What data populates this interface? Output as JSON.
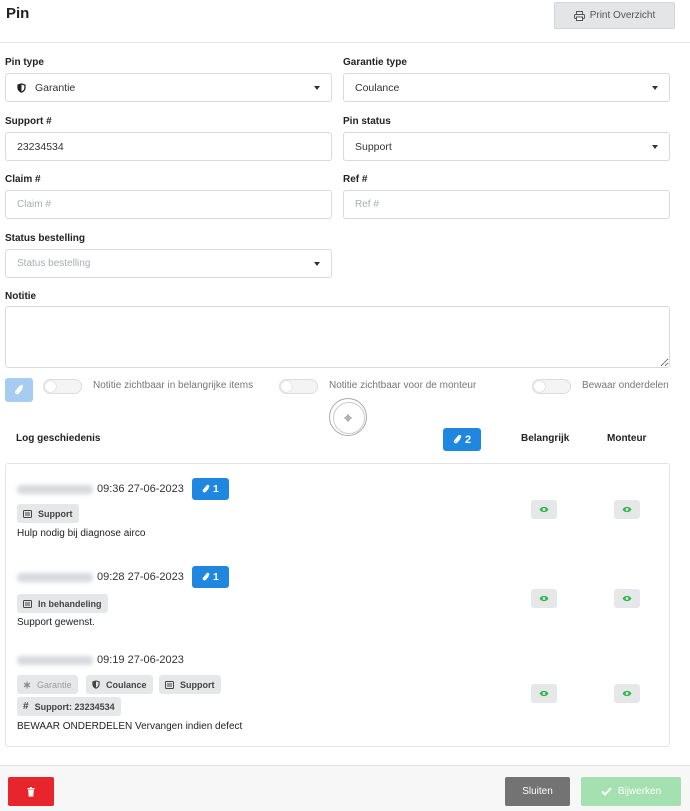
{
  "header": {
    "title": "Pin",
    "print_label": "Print Overzicht"
  },
  "form": {
    "pin_type": {
      "label": "Pin type",
      "value": "Garantie"
    },
    "garantie_type": {
      "label": "Garantie type",
      "value": "Coulance"
    },
    "support": {
      "label": "Support #",
      "value": "23234534"
    },
    "pin_status": {
      "label": "Pin status",
      "value": "Support"
    },
    "claim": {
      "label": "Claim #",
      "placeholder": "Claim #"
    },
    "ref": {
      "label": "Ref #",
      "placeholder": "Ref #"
    },
    "status_bestelling": {
      "label": "Status bestelling",
      "placeholder": "Status bestelling"
    },
    "notitie": {
      "label": "Notitie"
    }
  },
  "toggles": {
    "belangrijk_label": "Notitie zichtbaar in belangrijke items",
    "monteur_label": "Notitie zichtbaar voor de monteur",
    "onderdelen_label": "Bewaar onderdelen"
  },
  "log": {
    "title": "Log geschiedenis",
    "attachment_count": "2",
    "col_belangrijk": "Belangrijk",
    "col_monteur": "Monteur",
    "entries": [
      {
        "time": "09:36 27-06-2023",
        "attachments": "1",
        "tag_support": "Support",
        "text": "Hulp nodig bij diagnose airco"
      },
      {
        "time": "09:28 27-06-2023",
        "attachments": "1",
        "tag_status": "In behandeling",
        "text": "Support gewenst."
      },
      {
        "time": "09:19 27-06-2023",
        "tag_garantie": "Garantie",
        "tag_coulance": "Coulance",
        "tag_support": "Support",
        "tag_support_nr": "Support: 23234534",
        "text": "BEWAAR ONDERDELEN Vervangen indien defect"
      }
    ]
  },
  "footer": {
    "close_label": "Sluiten",
    "update_label": "Bijwerken"
  },
  "colors": {
    "primary": "#1f87e0",
    "danger": "#e8242c",
    "success_disabled": "#a4e0b0",
    "eye": "#2fb84a",
    "secondary": "#737373"
  }
}
